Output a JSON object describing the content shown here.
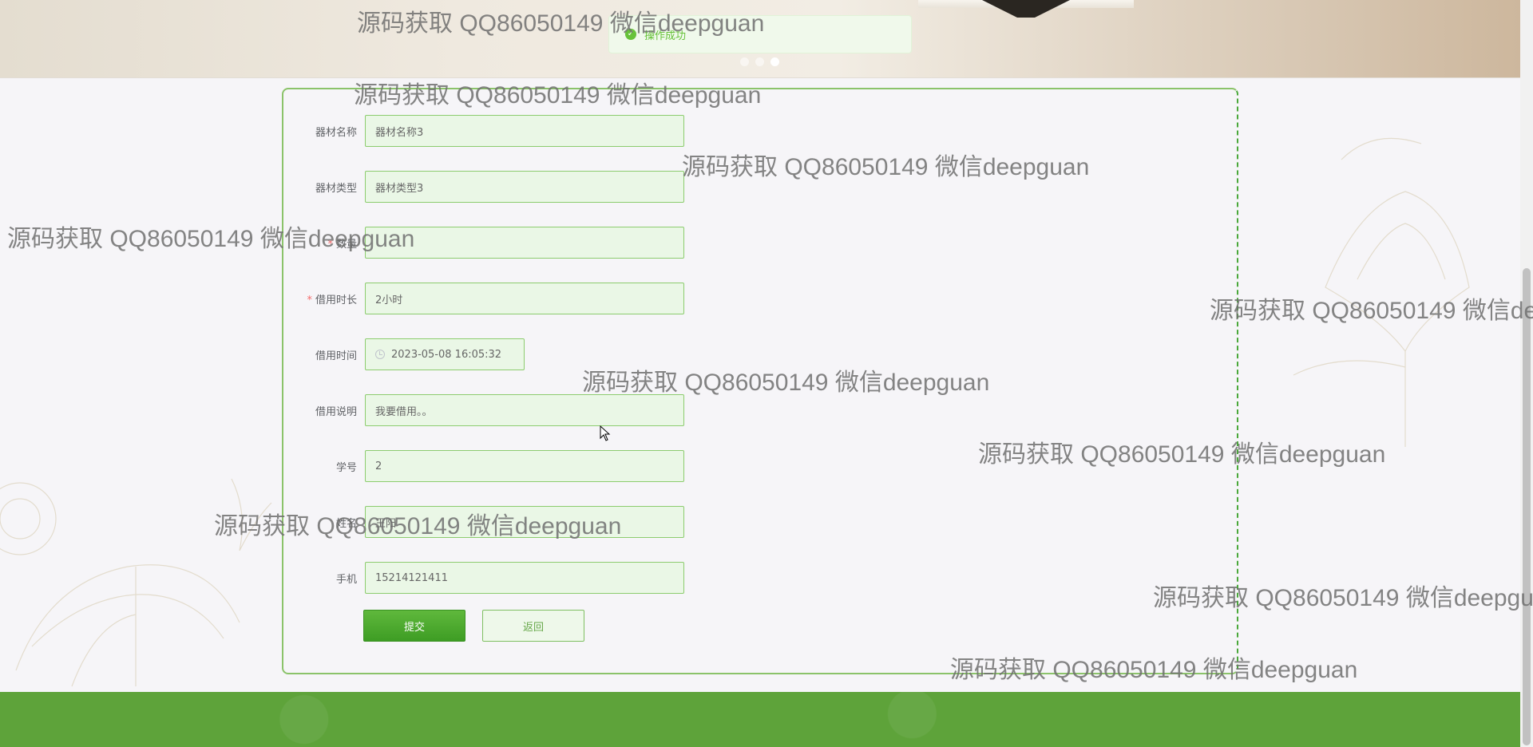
{
  "toast": {
    "message": "操作成功",
    "icon": "check-circle-icon"
  },
  "carousel": {
    "dot_count": 3,
    "active_index": 2
  },
  "form": {
    "fields": [
      {
        "label": "器材名称",
        "value": "器材名称3",
        "required": false
      },
      {
        "label": "器材类型",
        "value": "器材类型3",
        "required": false
      },
      {
        "label": "数量",
        "value": "",
        "required": true
      },
      {
        "label": "借用时长",
        "value": "2小时",
        "required": true
      },
      {
        "label": "借用时间",
        "value": "2023-05-08 16:05:32",
        "required": false
      },
      {
        "label": "借用说明",
        "value": "我要借用。。",
        "required": false
      },
      {
        "label": "学号",
        "value": "2",
        "required": false
      },
      {
        "label": "姓名",
        "value": "王阳",
        "required": false
      },
      {
        "label": "手机",
        "value": "15214121411",
        "required": false
      }
    ],
    "submit_label": "提交",
    "back_label": "返回"
  },
  "watermark": "源码获取 QQ86050149 微信deepguan",
  "colors": {
    "accent": "#67c23a",
    "footer": "#5ea33a",
    "field_bg": "#eaf7e6"
  }
}
